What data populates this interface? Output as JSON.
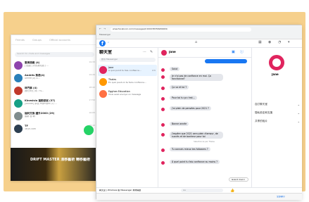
{
  "browser": {
    "url": "www.facebook.com/messages/t/100038356969969/",
    "tab_title": "Messenger"
  },
  "list": {
    "title": "聊天室",
    "search_placeholder": "搜尋 Messenger",
    "conversations": [
      {
        "name": "Jane",
        "preview": "A quoi point tu fais confiance...",
        "time": "2 h",
        "avatar_color": "#e0245e"
      },
      {
        "name": "Thales",
        "preview": "En quoi peut-on te faire confiance...",
        "time": "",
        "avatar_color": "#ff9800"
      },
      {
        "name": "Egghan Education",
        "preview": "Vous avez envoyé un message",
        "time": "",
        "avatar_color": "#ff7043"
      }
    ]
  },
  "conversation": {
    "name": "Jane",
    "messages": [
      {
        "text": "Salut",
        "side": "left"
      },
      {
        "text": "Je n'ai pas de confiance en moi. Ça fonctionne?",
        "side": "left"
      },
      {
        "text": "Ça va et toi ?",
        "side": "left"
      },
      {
        "text": "Pour toi tu ça c'est...",
        "side": "left"
      },
      {
        "text": "J'ai plein de pensées pour 2021 ?",
        "side": "left"
      },
      {
        "text": "Bonne année",
        "side": "left"
      },
      {
        "text": "J'espère que 2021 sera plein d'amour, de succès et de bonheur pour toi",
        "side": "left"
      },
      {
        "text": "Tu connais mieux tes followers ?",
        "side": "left"
      },
      {
        "text": "À quel point tu fais confiance au moins ?",
        "side": "left"
      }
    ],
    "stamp": "Sélectionné par Thales",
    "quick_reply": "Grand merci",
    "composer_label": "Aa"
  },
  "info": {
    "name": "Jane",
    "options": [
      {
        "label": "自訂聊天室"
      },
      {
        "label": "隱私設定和支援"
      },
      {
        "label": "共享的相片"
      }
    ]
  },
  "phone": {
    "top_tabs": [
      "Friends",
      "Groups",
      "Official accounts"
    ],
    "search_placeholder": "Search for chats and messages",
    "chats": [
      {
        "name": "雷奧德義 (4)",
        "preview": "[ 貼圖 ] 好的我知道了...",
        "time": "19:33",
        "color": "#8e44ad"
      },
      {
        "name": "Andrés 熟悉(4)",
        "preview": "Ufffffff (a) 4...",
        "time": "19:20",
        "color": "#2980b9"
      },
      {
        "name": "林門事 (4)",
        "preview": "我們大吃 (a) 7%...",
        "time": "18:42",
        "color": "#c0392b"
      },
      {
        "name": "Kinesislo 運動發展 (37)",
        "preview": "[Sticker] 恭喜 Highlight (1) ...",
        "time": "17:50",
        "color": "#16a085"
      },
      {
        "name": "福利交換 國外2000 (29)",
        "preview": "最新.台.轉",
        "time": "16:05",
        "color": "#7f8c8d"
      },
      {
        "name": "TF",
        "preview": "Taiyh.com",
        "time": "15:10",
        "color": "#2c3e50"
      }
    ],
    "poster_text": "DRIFT MASTER 漂移藝術 轉移藝術"
  },
  "taskbar": {
    "label": "聊天室 | Windows 版 Messenger 為你開啟",
    "status": "全部顯示"
  }
}
